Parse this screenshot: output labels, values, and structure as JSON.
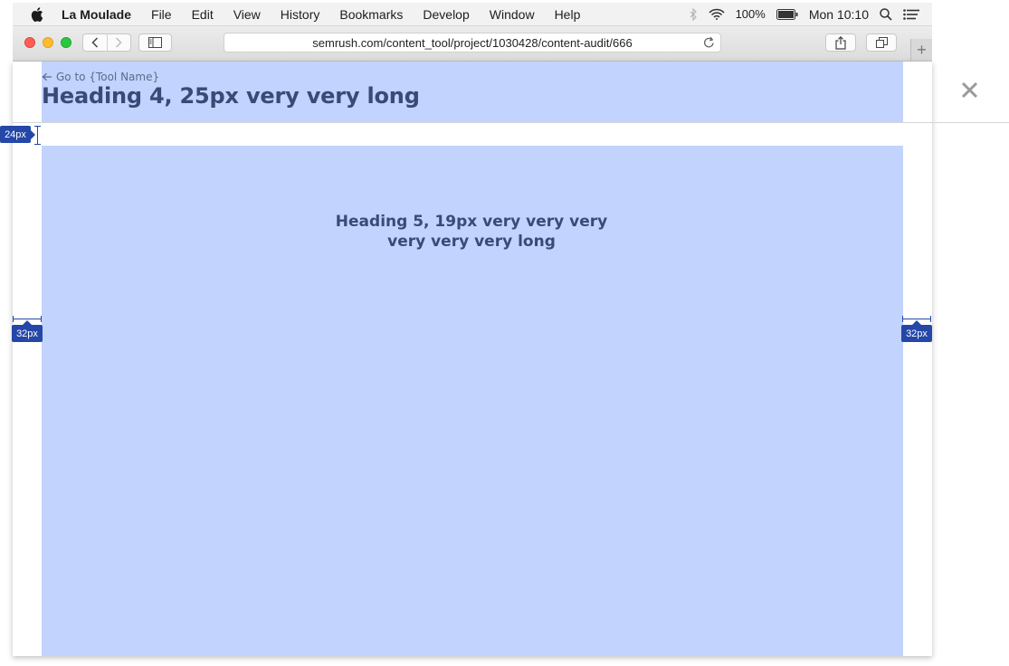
{
  "menubar": {
    "apple_icon": "apple-logo-icon",
    "app_name": "La Moulade",
    "items": [
      "File",
      "Edit",
      "View",
      "History",
      "Bookmarks",
      "Develop",
      "Window",
      "Help"
    ],
    "status": {
      "bluetooth_icon": "bluetooth-icon",
      "wifi_icon": "wifi-icon",
      "battery_percent": "100%",
      "battery_icon": "battery-icon",
      "clock": "Mon 10:10",
      "spotlight_icon": "search-icon",
      "notifications_icon": "list-icon"
    }
  },
  "browser": {
    "url": "semrush.com/content_tool/project/1030428/content-audit/666",
    "new_tab_glyph": "+"
  },
  "page": {
    "back_link": "Go to {Tool Name}",
    "title": "Heading 4, 25px very very long",
    "content_heading": "Heading 5, 19px very very very very very very long",
    "header_color": "#c2d3fd",
    "text_color": "#3a4a78"
  },
  "annotations": {
    "top_spacing": "24px",
    "left_padding": "32px",
    "right_padding": "32px",
    "badge_color": "#2447a8"
  }
}
